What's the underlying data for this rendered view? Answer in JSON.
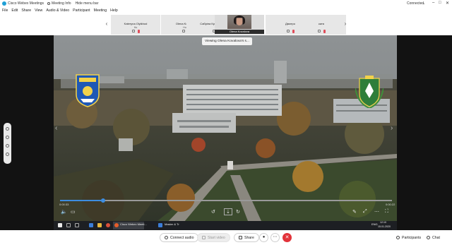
{
  "title_bar": {
    "app_title": "Cisco Webex Meetings",
    "meeting_info": "Meeting Info",
    "hide_menu": "Hide menu bar",
    "connection": "Connected",
    "controls": [
      "–",
      "□",
      "✕"
    ]
  },
  "menu": [
    "File",
    "Edit",
    "Share",
    "View",
    "Audio & Video",
    "Participant",
    "Meeting",
    "Help"
  ],
  "participants": [
    {
      "name": "Kateryna Olyikhod",
      "role": "Ho"
    },
    {
      "name": "Olena Kovalova",
      "role": "Host"
    },
    {
      "name": "Сабріна Краснопольсь...",
      "role": ""
    },
    {
      "name": "Olena Kovalova",
      "role": "",
      "has_video": true
    },
    {
      "name": "Дмитрo",
      "role": ""
    },
    {
      "name": "катя",
      "role": ""
    }
  ],
  "share": {
    "viewing_label": "Viewing Olena Kovalova's s...",
    "time_current": "0:00:33",
    "time_total": "0:00:22",
    "progress_fraction": 0.13
  },
  "taskbar": {
    "items": [
      "Cisco Webex Meeti...",
      "Master & Tr"
    ],
    "clock_time": "12:10",
    "clock_date": "15.01.2020",
    "lang": "ENG"
  },
  "bottom_bar": {
    "connect_audio": "Connect audio",
    "start_video": "Start video",
    "share": "Share",
    "participants": "Participants",
    "chat": "Chat"
  },
  "colors": {
    "end_call": "#e2333a",
    "progress_accent": "#3d8de0",
    "mute_red": "#e04d5a"
  }
}
